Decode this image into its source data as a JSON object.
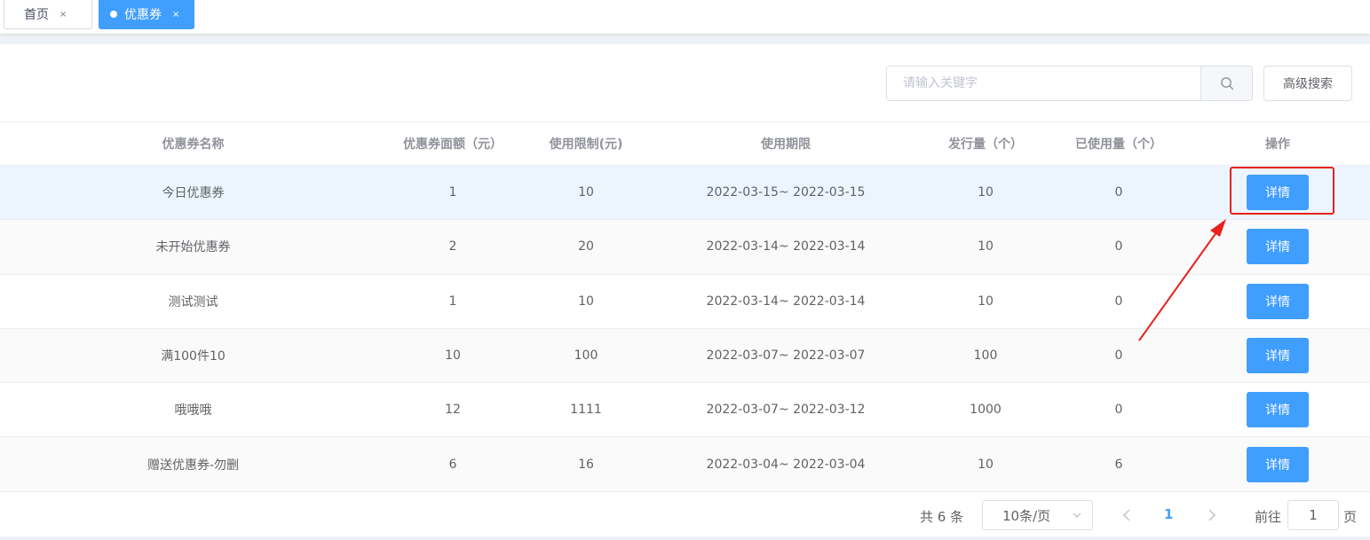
{
  "tabs": [
    {
      "label": "首页",
      "close": "×"
    },
    {
      "label": "优惠券",
      "close": "×"
    }
  ],
  "search": {
    "placeholder": "请输入关键字",
    "advanced_label": "高级搜索"
  },
  "table": {
    "columns": [
      "优惠券名称",
      "优惠券面额（元）",
      "使用限制(元)",
      "使用期限",
      "发行量（个）",
      "已使用量（个）",
      "操作"
    ],
    "rows": [
      {
        "name": "今日优惠券",
        "amount": "1",
        "limit": "10",
        "period": "2022-03-15~ 2022-03-15",
        "issued": "10",
        "used": "0",
        "action": "详情"
      },
      {
        "name": "未开始优惠券",
        "amount": "2",
        "limit": "20",
        "period": "2022-03-14~ 2022-03-14",
        "issued": "10",
        "used": "0",
        "action": "详情"
      },
      {
        "name": "测试测试",
        "amount": "1",
        "limit": "10",
        "period": "2022-03-14~ 2022-03-14",
        "issued": "10",
        "used": "0",
        "action": "详情"
      },
      {
        "name": "满100件10",
        "amount": "10",
        "limit": "100",
        "period": "2022-03-07~ 2022-03-07",
        "issued": "100",
        "used": "0",
        "action": "详情"
      },
      {
        "name": "哦哦哦",
        "amount": "12",
        "limit": "1111",
        "period": "2022-03-07~ 2022-03-12",
        "issued": "1000",
        "used": "0",
        "action": "详情"
      },
      {
        "name": "赠送优惠券-勿删",
        "amount": "6",
        "limit": "16",
        "period": "2022-03-04~ 2022-03-04",
        "issued": "10",
        "used": "6",
        "action": "详情"
      }
    ]
  },
  "pagination": {
    "total": "共 6 条",
    "page_size": "10条/页",
    "current_page": "1",
    "goto_label": "前往",
    "goto_value": "1",
    "page_suffix": "页"
  },
  "colors": {
    "primary": "#409eff",
    "annotation": "#e8211c"
  },
  "icons": {
    "search": "search-icon",
    "close": "close-icon",
    "prev": "chevron-left-icon",
    "next": "chevron-right-icon",
    "dropdown": "chevron-down-icon"
  }
}
